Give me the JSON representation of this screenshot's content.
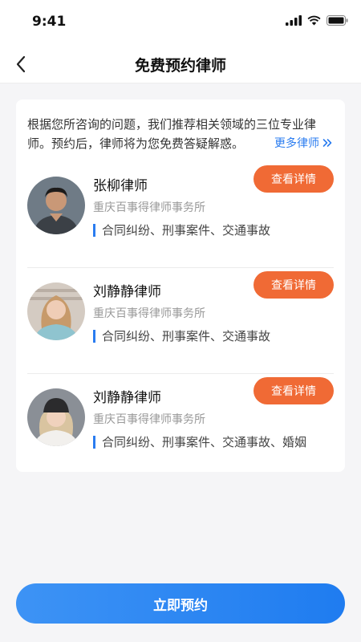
{
  "status": {
    "time": "9:41"
  },
  "nav": {
    "title": "免费预约律师"
  },
  "intro": {
    "text": "根据您所咨询的问题，我们推荐相关领域的三位专业律师。预约后，律师将为您免费答疑解惑。",
    "more_label": "更多律师"
  },
  "lawyers": [
    {
      "name": "张柳律师",
      "firm": "重庆百事得律师事务所",
      "tags": "合同纠纷、刑事案件、交通事故",
      "button": "查看详情"
    },
    {
      "name": "刘静静律师",
      "firm": "重庆百事得律师事务所",
      "tags": "合同纠纷、刑事案件、交通事故",
      "button": "查看详情"
    },
    {
      "name": "刘静静律师",
      "firm": "重庆百事得律师事务所",
      "tags": "合同纠纷、刑事案件、交通事故、婚姻",
      "button": "查看详情"
    }
  ],
  "footer": {
    "book_label": "立即预约"
  },
  "colors": {
    "accent": "#2a7cf0",
    "button": "#f06a35"
  }
}
